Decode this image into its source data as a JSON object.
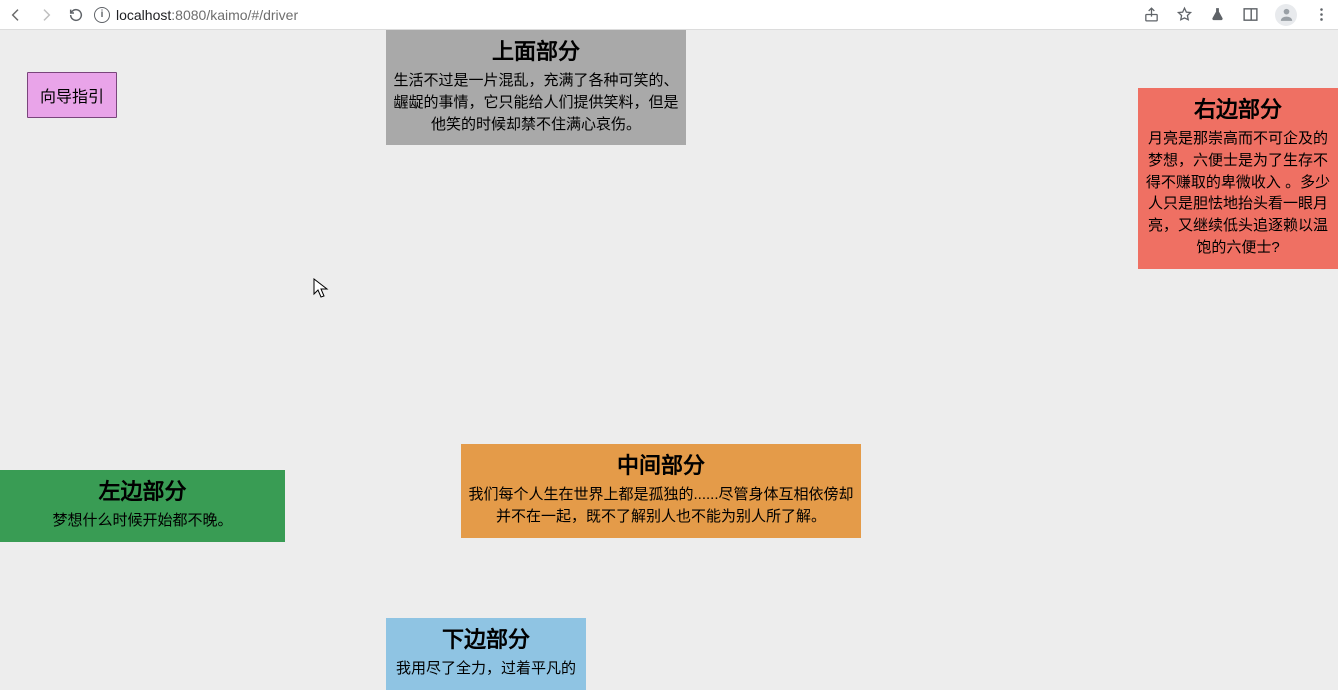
{
  "browser": {
    "url_host": "localhost",
    "url_port": ":8080",
    "url_path": "/kaimo/#/driver"
  },
  "button": {
    "guide": "向导指引"
  },
  "cards": {
    "top": {
      "title": "上面部分",
      "body": "生活不过是一片混乱，充满了各种可笑的、龌龊的事情，它只能给人们提供笑料，但是他笑的时候却禁不住满心哀伤。"
    },
    "right": {
      "title": "右边部分",
      "body": "月亮是那崇高而不可企及的梦想，六便士是为了生存不得不赚取的卑微收入 。多少人只是胆怯地抬头看一眼月亮，又继续低头追逐赖以温饱的六便士?"
    },
    "left": {
      "title": "左边部分",
      "body": "梦想什么时候开始都不晚。"
    },
    "mid": {
      "title": "中间部分",
      "body": "我们每个人生在世界上都是孤独的......尽管身体互相依傍却并不在一起，既不了解别人也不能为别人所了解。"
    },
    "bottom": {
      "title": "下边部分",
      "body": "我用尽了全力，过着平凡的"
    }
  },
  "colors": {
    "top": "#a9a9a9",
    "right": "#ef7063",
    "left": "#399c54",
    "mid": "#e49b49",
    "bottom": "#8fc4e3",
    "button_bg": "#e9a4e9"
  }
}
